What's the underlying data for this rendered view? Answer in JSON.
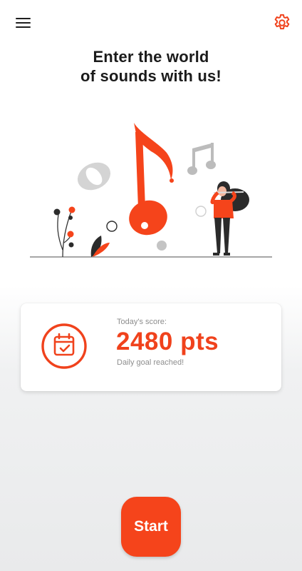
{
  "colors": {
    "accent": "#f5441b",
    "text": "#1b1b1b",
    "muted": "#8d8d8d"
  },
  "header": {
    "menu_icon": "hamburger-menu-icon",
    "settings_icon": "gear-icon"
  },
  "hero": {
    "line1": "Enter the world",
    "line2": "of sounds with us!"
  },
  "illustration": {
    "icon": "music-flute-illustration"
  },
  "score_card": {
    "icon": "calendar-check-icon",
    "label": "Today's score:",
    "value": "2480 pts",
    "status": "Daily goal reached!"
  },
  "start_button": {
    "label": "Start"
  }
}
